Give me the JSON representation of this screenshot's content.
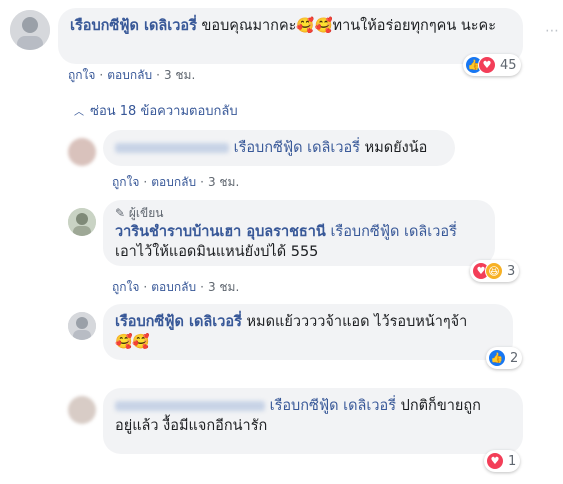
{
  "comments": [
    {
      "author": "เรือบกซีฟู้ด เดลิเวอรี่",
      "text": "ขอบคุณมากคะ🥰🥰ทานให้อร่อยทุกๆคน นะคะ",
      "actions": {
        "like": "ถูกใจ",
        "reply": "ตอบกลับ",
        "time": "3 ชม."
      },
      "reaction_count": "45"
    },
    {
      "hide_replies": "ซ่อน 18 ข้อความตอบกลับ"
    },
    {
      "tag": "เรือบกซีฟู้ด เดลิเวอรี่",
      "text": "หมดยังน้อ",
      "actions": {
        "like": "ถูกใจ",
        "reply": "ตอบกลับ",
        "time": "3 ชม."
      }
    },
    {
      "badge": "ผู้เขียน",
      "author": "วารินชำราบบ้านเฮา อุบลราชธานี",
      "tag": "เรือบกซีฟู้ด เดลิเวอรี่",
      "text": "เอาไว้ให้แอดมินแหน่ยังบ่ได้ 555",
      "actions": {
        "like": "ถูกใจ",
        "reply": "ตอบกลับ",
        "time": "3 ชม."
      },
      "reaction_count": "3"
    },
    {
      "author": "เรือบกซีฟู้ด เดลิเวอรี่",
      "text": "หมดแย้ววววจ้าแอด ไว้รอบหน้าๆจ้า",
      "emojis": "🥰🥰",
      "actions": {
        "like": "ถูกใจ",
        "reply": "ตอบกลับ",
        "time": "3 ชม."
      },
      "reaction_count": "2"
    },
    {
      "tag": "เรือบกซีฟู้ด เดลิเวอรี่",
      "text_line1": "ปกติก็ขายถูก",
      "text_line2": "อยู่แล้ว งื้อมีแจกอีกน่ารัก",
      "reaction_count": "1"
    }
  ],
  "colors": {
    "link": "#385898",
    "bubble": "#f2f3f5",
    "like": "#1877f2",
    "love": "#f33e58",
    "haha": "#f7b125"
  }
}
